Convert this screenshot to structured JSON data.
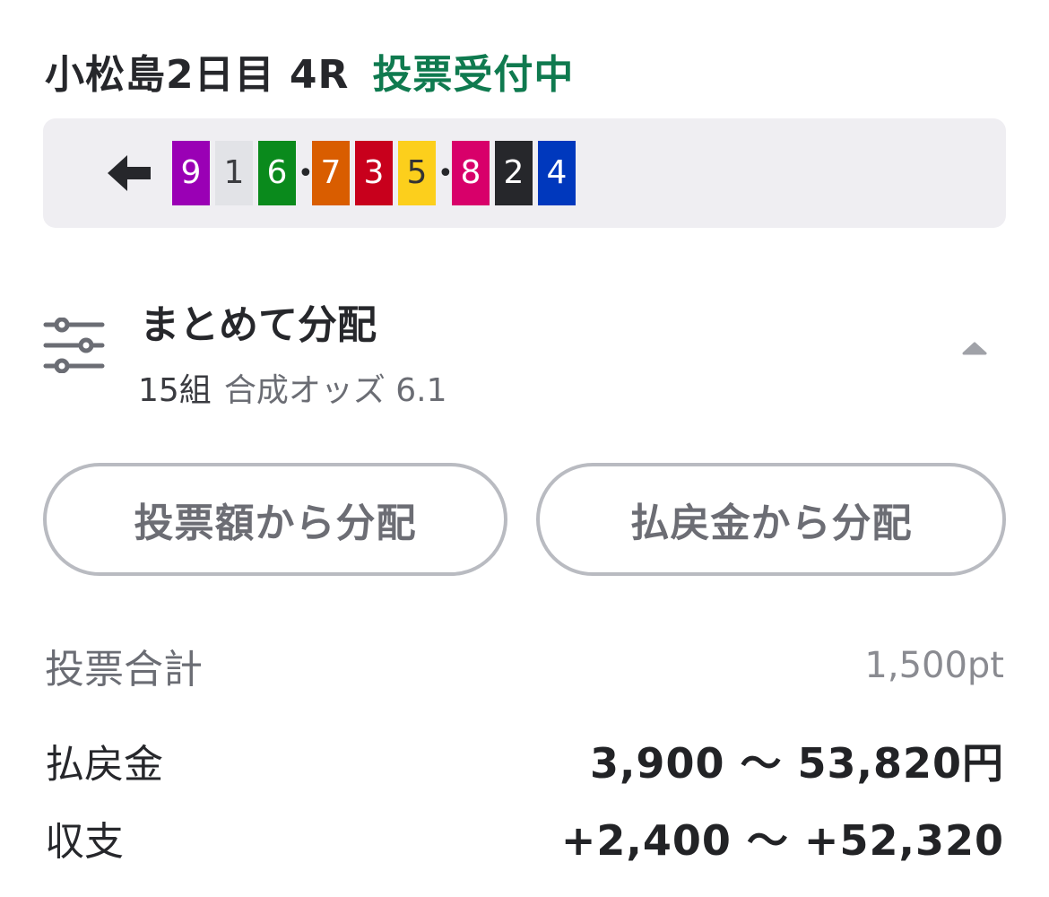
{
  "header": {
    "title": "小松島2日目 4R",
    "status": "投票受付中"
  },
  "colors": {
    "status": "#0f7a4f",
    "pick_box_bg": "#efeef2"
  },
  "picks": {
    "back_icon": "arrow-left-icon",
    "separator": "•",
    "groups": [
      [
        {
          "number": "9",
          "bg": "#9a00b5",
          "fg": "#ffffff"
        },
        {
          "number": "1",
          "bg": "#e2e3e7",
          "fg": "#3b3c40"
        },
        {
          "number": "6",
          "bg": "#0a8a1c",
          "fg": "#ffffff"
        }
      ],
      [
        {
          "number": "7",
          "bg": "#d95d00",
          "fg": "#ffffff"
        },
        {
          "number": "3",
          "bg": "#c8001c",
          "fg": "#ffffff"
        },
        {
          "number": "5",
          "bg": "#fccf1c",
          "fg": "#333333"
        }
      ],
      [
        {
          "number": "8",
          "bg": "#d8006a",
          "fg": "#ffffff"
        },
        {
          "number": "2",
          "bg": "#26272b",
          "fg": "#ffffff"
        },
        {
          "number": "4",
          "bg": "#0038bd",
          "fg": "#ffffff"
        }
      ]
    ]
  },
  "distribution": {
    "icon": "sliders-icon",
    "title": "まとめて分配",
    "count": "15組",
    "odds": "合成オッズ 6.1",
    "chevron": "chevron-up-icon"
  },
  "buttons": {
    "by_bet": "投票額から分配",
    "by_payout": "払戻金から分配"
  },
  "summary": {
    "total_label": "投票合計",
    "total_value": "1,500pt",
    "payout_label": "払戻金",
    "payout_value": "3,900 〜 53,820円",
    "balance_label": "収支",
    "balance_value": "+2,400 〜 +52,320"
  }
}
